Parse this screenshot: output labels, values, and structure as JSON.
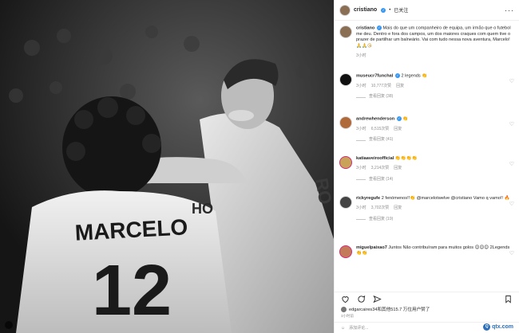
{
  "header": {
    "username": "cristiano",
    "follow_label": "已关注",
    "dot": "•",
    "more": "···"
  },
  "post": {
    "username": "cristiano",
    "caption": "Mais do que um companheiro de equipa, um irmão que o futebol me deu. Dentro e fora dos campos, um dos maiores craques com quem tive o prazer de partilhar um balneário. Vai com tudo nessa nova aventura, Marcelo!",
    "caption_emoji": "🙏🙏😘",
    "time": "3小时"
  },
  "comments": [
    {
      "username": "museucr7funchal",
      "text": "2 legends",
      "emoji": "👏",
      "time": "3小时",
      "likes": "10,777次赞",
      "reply": "回复",
      "replies": "查看回复 (38)"
    },
    {
      "username": "andrewhenderson",
      "text": "",
      "emoji": "👏",
      "time": "3小时",
      "likes": "6,515次赞",
      "reply": "回复",
      "replies": "查看回复 (41)"
    },
    {
      "username": "katiaaveiroofficial",
      "text": "",
      "emoji": "👏👏👏👏",
      "time": "3小时",
      "likes": "3,214次赞",
      "reply": "回复",
      "replies": "查看回复 (14)"
    },
    {
      "username": "rickyregufe",
      "text": "2 fenómenos!!👏 @marcelotwelve @cristiano Vamo q vamo!!",
      "emoji": "🔥",
      "time": "3小时",
      "likes": "3,702次赞",
      "reply": "回复",
      "replies": "查看回复 (19)"
    },
    {
      "username": "miguelpaixao7",
      "text": "Juntos Não contribuíram para muitos golos 😊😊😊 2Legends",
      "emoji": "👏👏",
      "time": "3小时",
      "likes": "",
      "reply": "",
      "replies": ""
    }
  ],
  "likes": {
    "text": "edgarcaires34和其他515.7 万位用户赞了",
    "time": "3小时前"
  },
  "add_comment": {
    "placeholder": "添加评论..."
  },
  "photo": {
    "jersey_name": "MARCELO",
    "jersey_number": "12",
    "back_text": "RO",
    "side_text": "HO"
  },
  "watermark": {
    "logo": "Q",
    "text": "qtx.com"
  }
}
